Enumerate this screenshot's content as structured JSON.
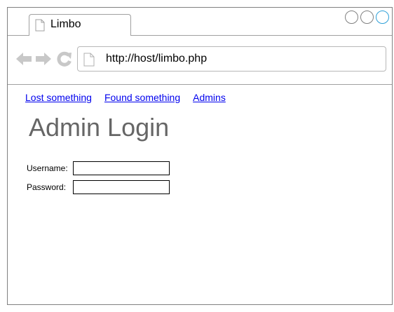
{
  "browser": {
    "tab_title": "Limbo",
    "url": "http://host/limbo.php",
    "window_controls": [
      "minimize-icon",
      "maximize-icon",
      "close-icon"
    ],
    "nav_icons": [
      "back-arrow-icon",
      "forward-arrow-icon",
      "reload-icon"
    ],
    "accent_color": "#2ea0d8"
  },
  "nav_links": [
    {
      "label": "Lost something"
    },
    {
      "label": "Found something"
    },
    {
      "label": "Admins"
    }
  ],
  "page": {
    "title": "Admin Login"
  },
  "form": {
    "username_label": "Username:",
    "username_value": "",
    "password_label": "Password:",
    "password_value": ""
  },
  "colors": {
    "link": "#0000ee",
    "title": "#666666",
    "icon_gray": "#c8c8c8"
  }
}
